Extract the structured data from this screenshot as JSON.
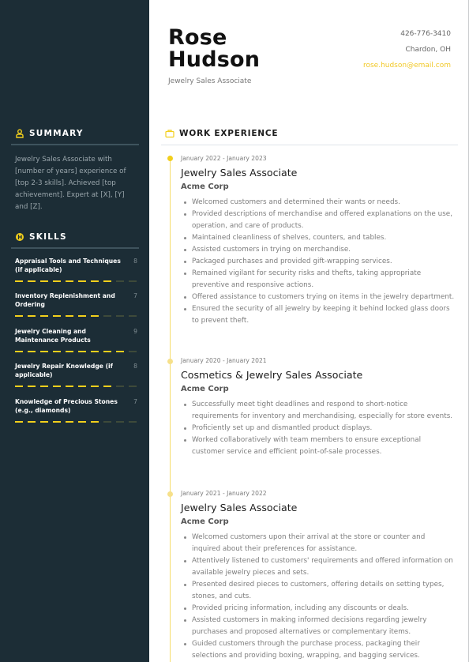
{
  "header": {
    "first_name": "Rose",
    "last_name": "Hudson",
    "title": "Jewelry Sales Associate",
    "phone": "426-776-3410",
    "location": "Chardon, OH",
    "email": "rose.hudson@email.com"
  },
  "colors": {
    "sidebar_bg": "#1c2d36",
    "accent": "#f2cf1c",
    "email": "#f2c928"
  },
  "summary": {
    "heading": "SUMMARY",
    "icon": "user-icon",
    "text": "Jewelry Sales Associate with [number of years] experience of [top 2-3 skills]. Achieved [top achievement]. Expert at [X], [Y] and [Z]."
  },
  "skills": {
    "heading": "SKILLS",
    "icon": "skills-icon",
    "max": 10,
    "items": [
      {
        "name": "Appraisal Tools and Techniques (if applicable)",
        "value": 8
      },
      {
        "name": "Inventory Replenishment and Ordering",
        "value": 7
      },
      {
        "name": "Jewelry Cleaning and Maintenance Products",
        "value": 9
      },
      {
        "name": "Jewelry Repair Knowledge (if applicable)",
        "value": 8
      },
      {
        "name": "Knowledge of Precious Stones (e.g., diamonds)",
        "value": 7
      }
    ]
  },
  "work": {
    "heading": "WORK EXPERIENCE",
    "icon": "briefcase-icon",
    "jobs": [
      {
        "dates": "January 2022 - January 2023",
        "title": "Jewelry Sales Associate",
        "company": "Acme Corp",
        "bullets": [
          "Welcomed customers and determined their wants or needs.",
          "Provided descriptions of merchandise and offered explanations on the use, operation, and care of products.",
          "Maintained cleanliness of shelves, counters, and tables.",
          "Assisted customers in trying on merchandise.",
          "Packaged purchases and provided gift-wrapping services.",
          "Remained vigilant for security risks and thefts, taking appropriate preventive and responsive actions.",
          "Offered assistance to customers trying on items in the jewelry department.",
          "Ensured the security of all jewelry by keeping it behind locked glass doors to prevent theft."
        ]
      },
      {
        "dates": "January 2020 - January 2021",
        "title": "Cosmetics & Jewelry Sales Associate",
        "company": "Acme Corp",
        "bullets": [
          "Successfully meet tight deadlines and respond to short-notice requirements for inventory and merchandising, especially for store events.",
          "Proficiently set up and dismantled product displays.",
          "Worked collaboratively with team members to ensure exceptional customer service and efficient point-of-sale processes."
        ]
      },
      {
        "dates": "January 2021 - January 2022",
        "title": "Jewelry Sales Associate",
        "company": "Acme Corp",
        "bullets": [
          "Welcomed customers upon their arrival at the store or counter and inquired about their preferences for assistance.",
          "Attentively listened to customers' requirements and offered information on available jewelry pieces and sets.",
          "Presented desired pieces to customers, offering details on setting types, stones, and cuts.",
          "Provided pricing information, including any discounts or deals.",
          "Assisted customers in making informed decisions regarding jewelry purchases and proposed alternatives or complementary items.",
          "Guided customers through the purchase process, packaging their selections and providing boxing, wrapping, and bagging services."
        ]
      }
    ]
  }
}
